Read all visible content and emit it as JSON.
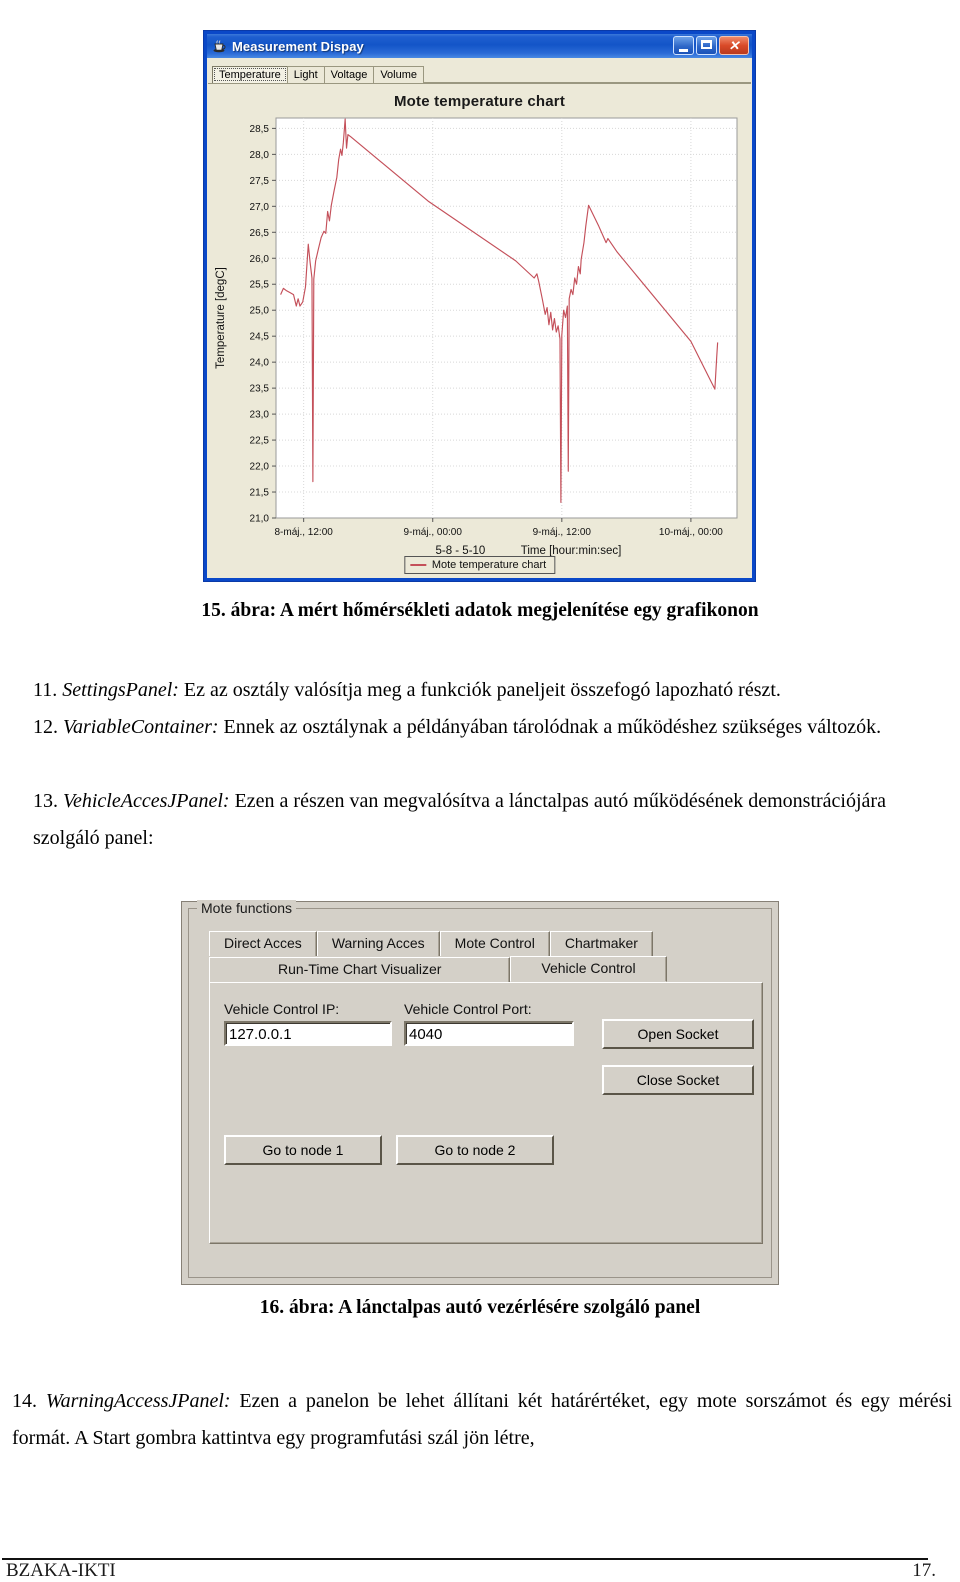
{
  "measurement_window": {
    "title": "Measurement Dispay",
    "app_icon": "duke-coffee-icon",
    "window_buttons": {
      "minimize": "minimize-icon",
      "maximize": "maximize-icon",
      "close": "✕"
    },
    "tabs": [
      {
        "label": "Temperature",
        "selected": true
      },
      {
        "label": "Light",
        "selected": false
      },
      {
        "label": "Voltage",
        "selected": false
      },
      {
        "label": "Volume",
        "selected": false
      }
    ],
    "legend_label": "Mote temperature chart"
  },
  "chart_data": {
    "type": "line",
    "title": "Mote temperature chart",
    "xlabel": "5-8 - 5-10    Time [hour:min:sec]",
    "xlabel_range": "5-8 - 5-10",
    "xlabel_axis": "Time [hour:min:sec]",
    "ylabel": "Temperature [degC]",
    "ylim": [
      21.0,
      28.7
    ],
    "yticks": [
      "28,5",
      "28,0",
      "27,5",
      "27,0",
      "26,5",
      "26,0",
      "25,5",
      "25,0",
      "24,5",
      "24,0",
      "23,5",
      "23,0",
      "22,5",
      "22,0",
      "21,5",
      "21,0"
    ],
    "ytick_values": [
      28.5,
      28.0,
      27.5,
      27.0,
      26.5,
      26.0,
      25.5,
      25.0,
      24.5,
      24.0,
      23.5,
      23.0,
      22.5,
      22.0,
      21.5,
      21.0
    ],
    "xticks": [
      "8-máj., 12:00",
      "9-máj., 00:00",
      "9-máj., 12:00",
      "10-máj., 00:00"
    ],
    "xtick_positions": [
      0.06,
      0.34,
      0.62,
      0.9
    ],
    "grid": true,
    "legend": [
      "Mote temperature chart"
    ],
    "legend_position": "bottom-center",
    "line_color": "#c4505a",
    "series": [
      {
        "name": "Mote temperature chart",
        "points": [
          [
            0.01,
            25.3
          ],
          [
            0.016,
            25.42
          ],
          [
            0.022,
            25.38
          ],
          [
            0.03,
            25.34
          ],
          [
            0.038,
            25.3
          ],
          [
            0.044,
            25.08
          ],
          [
            0.048,
            25.22
          ],
          [
            0.052,
            25.08
          ],
          [
            0.058,
            25.16
          ],
          [
            0.064,
            25.45
          ],
          [
            0.07,
            26.27
          ],
          [
            0.074,
            25.92
          ],
          [
            0.078,
            25.62
          ],
          [
            0.08,
            21.7
          ],
          [
            0.082,
            25.6
          ],
          [
            0.086,
            25.95
          ],
          [
            0.092,
            26.18
          ],
          [
            0.098,
            26.4
          ],
          [
            0.104,
            26.52
          ],
          [
            0.108,
            26.48
          ],
          [
            0.112,
            26.9
          ],
          [
            0.116,
            26.72
          ],
          [
            0.12,
            27.02
          ],
          [
            0.126,
            27.3
          ],
          [
            0.132,
            27.56
          ],
          [
            0.136,
            27.9
          ],
          [
            0.14,
            28.1
          ],
          [
            0.143,
            27.98
          ],
          [
            0.146,
            28.22
          ],
          [
            0.15,
            28.68
          ],
          [
            0.153,
            28.12
          ],
          [
            0.156,
            28.38
          ],
          [
            0.162,
            28.34
          ],
          [
            0.33,
            27.1
          ],
          [
            0.52,
            25.95
          ],
          [
            0.56,
            25.62
          ],
          [
            0.566,
            25.7
          ],
          [
            0.57,
            25.55
          ],
          [
            0.578,
            25.2
          ],
          [
            0.584,
            24.92
          ],
          [
            0.588,
            25.05
          ],
          [
            0.592,
            24.72
          ],
          [
            0.596,
            24.96
          ],
          [
            0.6,
            24.62
          ],
          [
            0.604,
            24.84
          ],
          [
            0.608,
            24.58
          ],
          [
            0.612,
            24.7
          ],
          [
            0.616,
            24.45
          ],
          [
            0.618,
            21.3
          ],
          [
            0.62,
            24.52
          ],
          [
            0.624,
            25.0
          ],
          [
            0.628,
            24.86
          ],
          [
            0.632,
            25.08
          ],
          [
            0.634,
            21.9
          ],
          [
            0.636,
            25.22
          ],
          [
            0.64,
            25.4
          ],
          [
            0.644,
            25.3
          ],
          [
            0.648,
            25.62
          ],
          [
            0.652,
            25.5
          ],
          [
            0.656,
            25.84
          ],
          [
            0.66,
            25.7
          ],
          [
            0.662,
            25.98
          ],
          [
            0.668,
            26.3
          ],
          [
            0.672,
            26.62
          ],
          [
            0.678,
            27.02
          ],
          [
            0.7,
            26.62
          ],
          [
            0.712,
            26.38
          ],
          [
            0.716,
            26.3
          ],
          [
            0.72,
            26.38
          ],
          [
            0.74,
            26.12
          ],
          [
            0.9,
            24.4
          ],
          [
            0.952,
            23.48
          ],
          [
            0.956,
            24.1
          ],
          [
            0.958,
            24.38
          ]
        ]
      }
    ]
  },
  "figure_15_caption": "15.  ábra: A mért hőmérsékleti adatok megjelenítése egy grafikonon",
  "figure_16_caption": "16.  ábra: A lánctalpas autó vezérlésére szolgáló panel",
  "paragraphs": [
    {
      "number": "11.",
      "term": "SettingsPanel:",
      "text": " Ez az osztály valósítja meg a funkciók paneljeit összefogó lapozható részt."
    },
    {
      "number": "12.",
      "term": "VariableContainer:",
      "text": " Ennek az osztálynak a példányában tárolódnak a működéshez szükséges változók."
    },
    {
      "number": "13.",
      "term": "VehicleAccesJPanel:",
      "text": " Ezen a részen van megvalósítva a lánctalpas autó működésének demonstrációjára szolgáló panel:"
    },
    {
      "number": "14.",
      "term": "WarningAccessJPanel:",
      "text": " Ezen a panelon be lehet állítani két határértéket, egy mote sorszámot és egy mérési formát. A Start gombra kattintva egy programfutási szál jön létre,"
    }
  ],
  "mote_panel": {
    "group_title": "Mote functions",
    "tabs_row1": [
      {
        "label": "Direct Acces",
        "selected": false
      },
      {
        "label": "Warning Acces",
        "selected": false
      },
      {
        "label": "Mote Control",
        "selected": false
      },
      {
        "label": "Chartmaker",
        "selected": false
      }
    ],
    "tabs_row2": [
      {
        "label": "Run-Time Chart Visualizer",
        "selected": false
      },
      {
        "label": "Vehicle Control",
        "selected": true
      }
    ],
    "ip_label": "Vehicle Control IP:",
    "ip_value": "127.0.0.1",
    "port_label": "Vehicle Control Port:",
    "port_value": "4040",
    "open_socket_label": "Open Socket",
    "close_socket_label": "Close Socket",
    "node1_label": "Go to node 1",
    "node2_label": "Go to node 2"
  },
  "footer": {
    "left": "BZAKA-IKTI",
    "right": "17."
  }
}
